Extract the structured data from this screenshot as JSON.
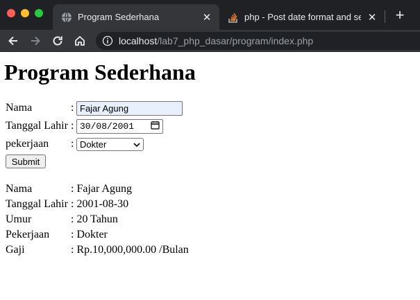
{
  "browser": {
    "tabs": [
      {
        "title": "Program Sederhana",
        "active": true,
        "icon": "globe-icon"
      },
      {
        "title": "php - Post date format and sele",
        "active": false,
        "icon": "stackoverflow-icon"
      }
    ],
    "url": {
      "host": "localhost",
      "path": "/lab7_php_dasar/program/index.php"
    }
  },
  "page": {
    "title": "Program Sederhana",
    "form": {
      "nama": {
        "label": "Nama",
        "colon": ":",
        "value": "Fajar Agung"
      },
      "tanggal_lahir": {
        "label": "Tanggal Lahir",
        "colon": ":",
        "value": "30/08/2001"
      },
      "pekerjaan": {
        "label": "pekerjaan",
        "colon": ":",
        "selected": "Dokter"
      },
      "submit_label": "Submit"
    },
    "result": [
      {
        "label": "Nama",
        "value": ": Fajar Agung"
      },
      {
        "label": "Tanggal Lahir",
        "value": ": 2001-08-30"
      },
      {
        "label": "Umur",
        "value": ": 20 Tahun"
      },
      {
        "label": "Pekerjaan",
        "value": ": Dokter"
      },
      {
        "label": "Gaji",
        "value": ": Rp.10,000,000.00 /Bulan"
      }
    ]
  },
  "colors": {
    "tabbar": "#202124",
    "active_tab": "#35363a",
    "autofill": "#e8f0fe",
    "close_red": "#ff5f57",
    "minimize_yellow": "#febc2e",
    "zoom_green": "#28c840"
  }
}
